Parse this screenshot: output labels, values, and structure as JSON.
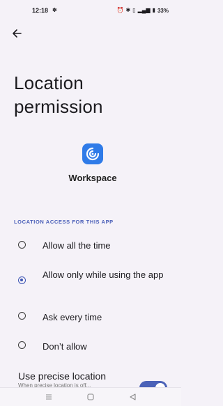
{
  "status_bar": {
    "time": "12:18",
    "battery": "33%"
  },
  "page": {
    "title": "Location permission"
  },
  "app": {
    "name": "Workspace",
    "icon": "workspace-app-icon",
    "accent": "#2f7be8"
  },
  "section": {
    "header": "LOCATION ACCESS FOR THIS APP"
  },
  "options": [
    {
      "label": "Allow all the time",
      "selected": false
    },
    {
      "label": "Allow only while using the app",
      "selected": true
    },
    {
      "label": "Ask every time",
      "selected": false
    },
    {
      "label": "Don’t allow",
      "selected": false
    }
  ],
  "precise": {
    "title": "Use precise location",
    "subtitle": "When precise location is off...",
    "enabled": true
  },
  "colors": {
    "accent": "#3e56b4",
    "background": "#f5f2f8"
  }
}
